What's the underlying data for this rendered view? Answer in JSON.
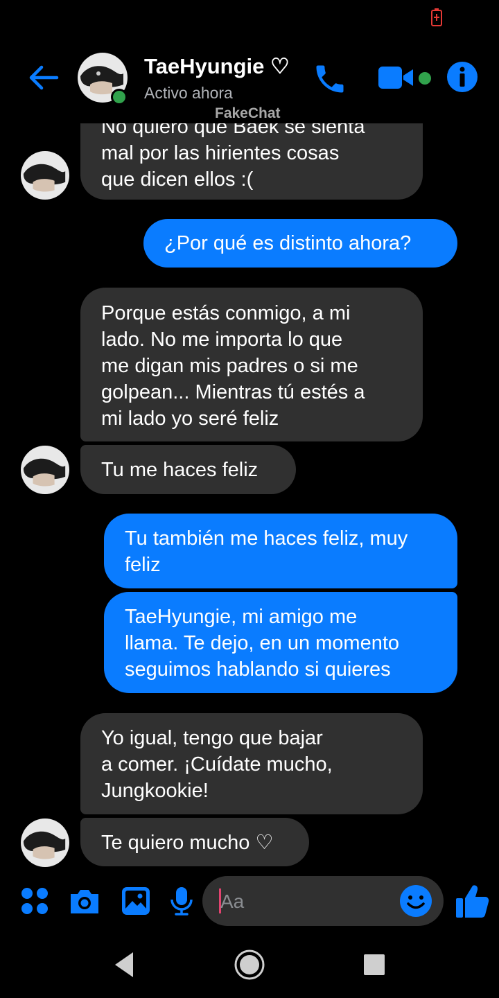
{
  "header": {
    "contact_name": "TaeHyungie ♡",
    "status": "Activo ahora",
    "watermark": "FakeChat"
  },
  "messages": [
    {
      "from": "them",
      "lines": [
        "No quiero que Baek se sienta",
        "mal por las hirientes cosas",
        "que dicen ellos :("
      ]
    },
    {
      "from": "me",
      "lines": [
        "¿Por qué es distinto ahora?"
      ]
    },
    {
      "from": "them",
      "lines": [
        "Porque estás conmigo, a mi",
        "lado. No me importa lo que",
        "me digan mis padres o si me",
        "golpean... Mientras tú estés a",
        "mi lado yo seré feliz"
      ]
    },
    {
      "from": "them",
      "lines": [
        "Tu me haces feliz"
      ]
    },
    {
      "from": "me",
      "lines": [
        "Tu también me haces feliz, muy",
        "feliz"
      ]
    },
    {
      "from": "me",
      "lines": [
        "TaeHyungie, mi amigo me",
        "llama. Te dejo, en un momento",
        "seguimos hablando si quieres"
      ]
    },
    {
      "from": "them",
      "lines": [
        "Yo igual, tengo que bajar",
        "a comer. ¡Cuídate mucho,",
        "Jungkookie!"
      ]
    },
    {
      "from": "them",
      "lines": [
        "Te quiero mucho ♡"
      ]
    }
  ],
  "composer": {
    "placeholder": "Aa"
  },
  "colors": {
    "accent": "#0a7cff",
    "incoming_bubble": "#303030",
    "online": "#31a24c",
    "background": "#000000"
  },
  "icons": [
    "back-arrow-icon",
    "phone-icon",
    "video-camera-icon",
    "info-icon",
    "apps-grid-icon",
    "camera-icon",
    "image-icon",
    "microphone-icon",
    "emoji-icon",
    "thumbs-up-icon",
    "nav-back-icon",
    "nav-home-icon",
    "nav-recents-icon"
  ]
}
